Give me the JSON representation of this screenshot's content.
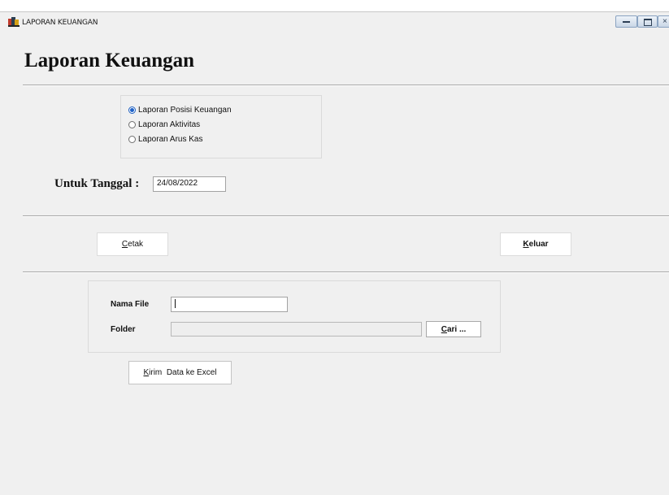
{
  "window": {
    "title": "LAPORAN KEUANGAN",
    "icons": {
      "app": "report-icon",
      "minimize": "minimize-icon",
      "maximize": "maximize-icon",
      "close": "close-icon"
    },
    "close_glyph": "×"
  },
  "heading": "Laporan Keuangan",
  "report_options": {
    "selected_index": 0,
    "items": [
      {
        "label": "Laporan Posisi Keuangan",
        "checked": true
      },
      {
        "label": "Laporan Aktivitas",
        "checked": false
      },
      {
        "label": "Laporan Arus Kas",
        "checked": false
      }
    ]
  },
  "date": {
    "label": "Untuk Tanggal :",
    "value": "24/08/2022"
  },
  "actions": {
    "print": {
      "hotkey": "C",
      "rest": "etak"
    },
    "exit": {
      "hotkey": "K",
      "rest": "eluar"
    }
  },
  "export": {
    "filename_label": "Nama File",
    "filename_value": "",
    "folder_label": "Folder",
    "folder_value": "",
    "browse": {
      "hotkey": "C",
      "rest": "ari ..."
    },
    "send": {
      "hotkey": "K",
      "rest": "irim  Data ke Excel"
    }
  },
  "colors": {
    "accent": "#1f62c8",
    "window_bg": "#f0f0f0"
  }
}
